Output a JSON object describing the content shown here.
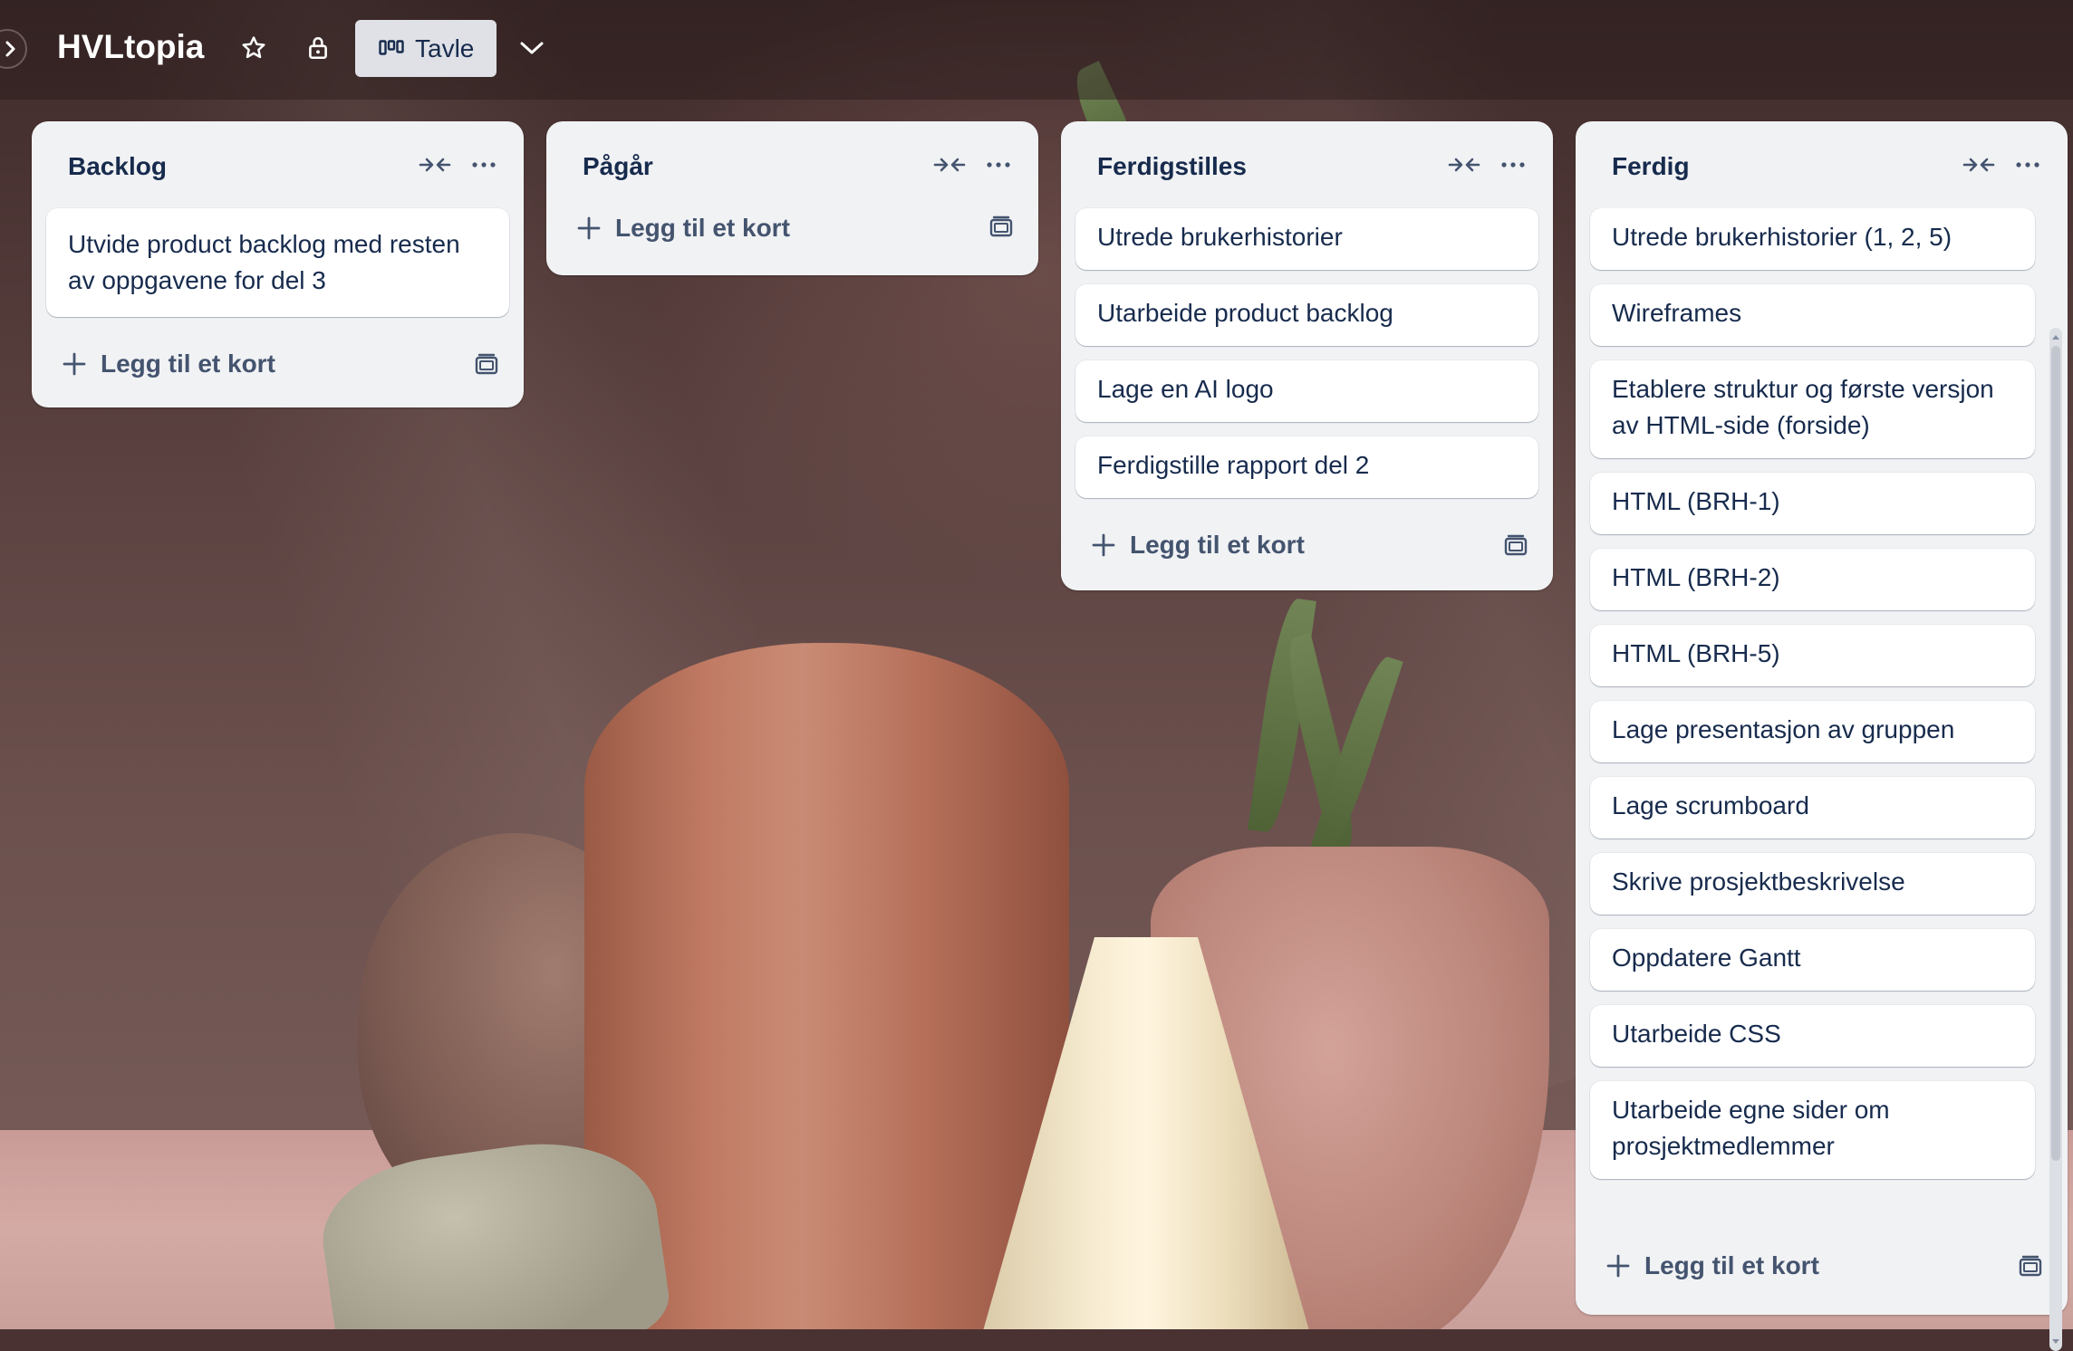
{
  "board": {
    "title": "HVLtopia",
    "view_label": "Tavle"
  },
  "lists": [
    {
      "title": "Backlog",
      "cards": [
        "Utvide product backlog med resten av oppgavene for del 3"
      ],
      "add_label": "Legg til et kort"
    },
    {
      "title": "Pågår",
      "cards": [],
      "add_label": "Legg til et kort"
    },
    {
      "title": "Ferdigstilles",
      "cards": [
        "Utrede brukerhistorier",
        "Utarbeide product backlog",
        "Lage en AI logo",
        "Ferdigstille rapport del 2"
      ],
      "add_label": "Legg til et kort"
    },
    {
      "title": "Ferdig",
      "cards": [
        "Utrede brukerhistorier (1, 2, 5)",
        "Wireframes",
        "Etablere struktur og første versjon av HTML-side (forside)",
        "HTML (BRH-1)",
        "HTML (BRH-2)",
        "HTML (BRH-5)",
        "Lage presentasjon av gruppen",
        "Lage scrumboard",
        "Skrive prosjektbeskrivelse",
        "Oppdatere Gantt",
        "Utarbeide CSS",
        "Utarbeide egne sider om prosjektmedlemmer"
      ],
      "add_label": "Legg til et kort"
    }
  ],
  "icons": {
    "sidebar_toggle": "chevron-right-icon",
    "star": "star-icon",
    "visibility": "lock-icon",
    "view": "board-icon",
    "view_switcher": "chevron-down-icon",
    "collapse": "collapse-icon",
    "more": "more-icon",
    "add": "plus-icon",
    "template": "template-icon"
  },
  "colors": {
    "list_bg": "#f1f2f4",
    "card_bg": "#ffffff",
    "text": "#172b4d",
    "view_button_bg": "#dfe1e6"
  }
}
